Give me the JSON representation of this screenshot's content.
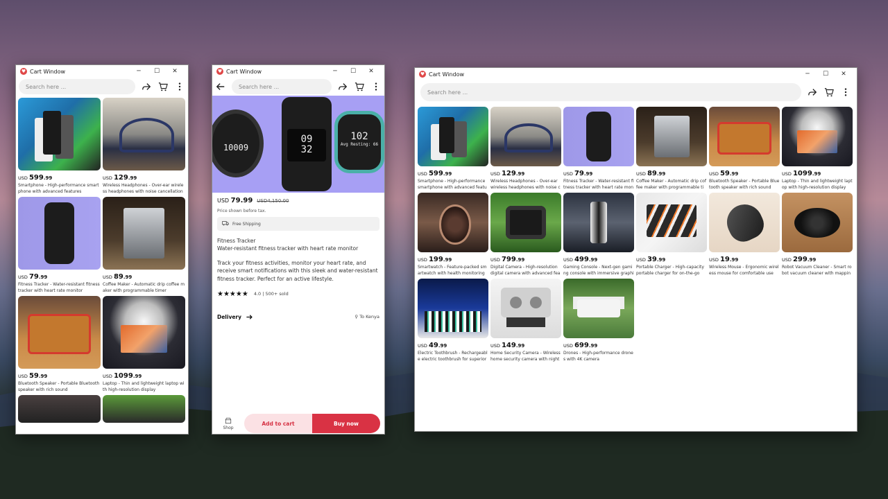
{
  "window_title": "Cart Window",
  "search_placeholder": "Search here ...",
  "window_controls": {
    "minimize": "─",
    "maximize": "☐",
    "close": "✕"
  },
  "currency": "USD",
  "products": [
    {
      "price_main": "599",
      "price_cents": ".99",
      "desc": "Smartphone - High-performance smartphone with advanced features",
      "art": "phone"
    },
    {
      "price_main": "129",
      "price_cents": ".99",
      "desc": "Wireless Headphones - Over-ear wireless headphones with noise cancellation",
      "art": "head"
    },
    {
      "price_main": "79",
      "price_cents": ".99",
      "desc": "Fitness Tracker - Water-resistant fitness tracker with heart rate monitor",
      "art": "watch"
    },
    {
      "price_main": "89",
      "price_cents": ".99",
      "desc": "Coffee Maker - Automatic drip coffee maker with programmable timer",
      "art": "coffee"
    },
    {
      "price_main": "59",
      "price_cents": ".99",
      "desc": "Bluetooth Speaker - Portable Bluetooth speaker with rich sound",
      "art": "speaker"
    },
    {
      "price_main": "1099",
      "price_cents": ".99",
      "desc": "Laptop - Thin and lightweight laptop with high-resolution display",
      "art": "laptop"
    },
    {
      "price_main": "199",
      "price_cents": ".99",
      "desc": "Smartwatch - Feature-packed smartwatch with health monitoring",
      "art": "smwatch"
    },
    {
      "price_main": "799",
      "price_cents": ".99",
      "desc": "Digital Camera - High-resolution digital camera with advanced features",
      "art": "camera"
    },
    {
      "price_main": "499",
      "price_cents": ".99",
      "desc": "Gaming Console - Next-gen gaming console with immersive graphics",
      "art": "console"
    },
    {
      "price_main": "39",
      "price_cents": ".99",
      "desc": "Portable Charger - High-capacity portable charger for on-the-go",
      "art": "charger"
    },
    {
      "price_main": "19",
      "price_cents": ".99",
      "desc": "Wireless Mouse - Ergonomic wireless mouse for comfortable use",
      "art": "mouse"
    },
    {
      "price_main": "299",
      "price_cents": ".99",
      "desc": "Robot Vacuum Cleaner - Smart robot vacuum cleaner with mapping",
      "art": "vacuum"
    },
    {
      "price_main": "49",
      "price_cents": ".99",
      "desc": "Electric Toothbrush - Rechargeable electric toothbrush for superior cleaning",
      "art": "brush"
    },
    {
      "price_main": "149",
      "price_cents": ".99",
      "desc": "Home Security Camera - Wireless home security camera with night vision",
      "art": "security"
    },
    {
      "price_main": "699",
      "price_cents": ".99",
      "desc": "Drones - High-performance drones with 4K camera",
      "art": "drone"
    }
  ],
  "detail": {
    "hero_left": "10009",
    "hero_center_1": "09",
    "hero_center_2": "32",
    "hero_right": "102",
    "hero_right_sub": "Avg Resting: 66",
    "price_main": "79",
    "price_cents": ".99",
    "old_price": "USD4,150.00",
    "tax_note": "Price shown before tax.",
    "shipping": "Free Shipping",
    "category": "Fitness Tracker",
    "subtitle": "Water-resistant fitness tracker with heart rate monitor",
    "long_desc": "Track your fitness activities, monitor your heart rate, and receive smart notifications with this sleek and water-resistant fitness tracker. Perfect for an active lifestyle.",
    "stars": "★★★★★",
    "rating": "4.0 | 500+ sold",
    "delivery": "Delivery",
    "deliver_to": "To Kenya",
    "shop": "Shop",
    "add_to_cart": "Add to cart",
    "buy_now": "Buy now"
  },
  "colors": {
    "accent": "#d93244",
    "accent_light": "#fbe1e4",
    "hero_bg": "#a79ff4"
  }
}
